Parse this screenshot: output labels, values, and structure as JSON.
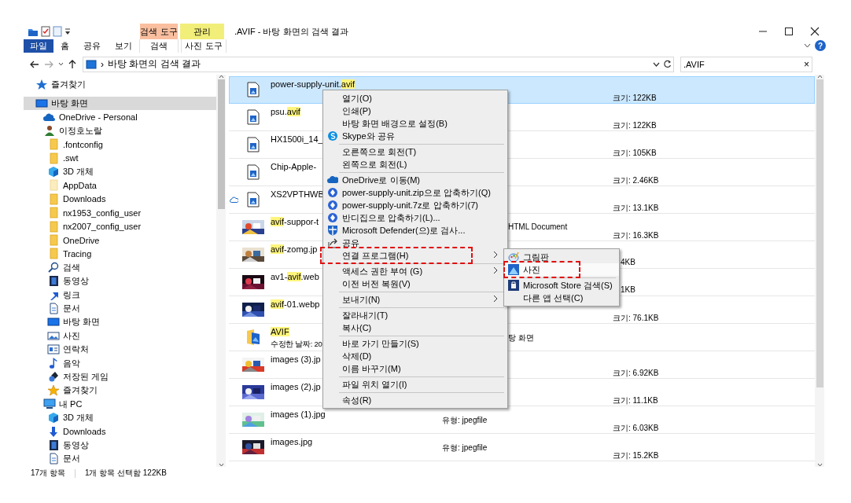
{
  "window": {
    "title": ".AVIF - 바탕 화면의 검색 결과"
  },
  "context_tab_headers": [
    {
      "label": "검색 도구",
      "color": "#f9bf9f"
    },
    {
      "label": "관리",
      "color": "#f2ee7a"
    }
  ],
  "ribbon_tabs": [
    {
      "label": "파일",
      "kind": "file",
      "selected": false
    },
    {
      "label": "홈",
      "kind": "tab",
      "selected": false
    },
    {
      "label": "공유",
      "kind": "tab",
      "selected": false
    },
    {
      "label": "보기",
      "kind": "tab",
      "selected": false
    },
    {
      "label": "검색",
      "kind": "context",
      "selected": false
    },
    {
      "label": "사진 도구",
      "kind": "context",
      "selected": false
    }
  ],
  "help": "?",
  "address_bar": {
    "separator": "›",
    "path": "바탕 화면의 검색 결과"
  },
  "search": {
    "value": ".AVIF",
    "clear": "×"
  },
  "navigation": [
    {
      "label": "즐겨찾기",
      "kind": "star",
      "selected": false
    },
    {
      "label": "바탕 화면",
      "kind": "desktop",
      "selected": true,
      "children": [
        {
          "label": "OneDrive - Personal",
          "kind": "cloud",
          "selected": false
        },
        {
          "label": "이정호노랄",
          "kind": "user",
          "selected": false,
          "children": [
            {
              "label": ".fontconfig",
              "kind": "folder",
              "selected": false
            },
            {
              "label": ".swt",
              "kind": "folder",
              "selected": false
            },
            {
              "label": "3D 개체",
              "kind": "cube",
              "selected": false
            },
            {
              "label": "AppData",
              "kind": "folder-faded",
              "selected": false
            },
            {
              "label": "Downloads",
              "kind": "folder",
              "selected": false
            },
            {
              "label": "nx1953_config_user",
              "kind": "folder",
              "selected": false
            },
            {
              "label": "nx2007_config_user",
              "kind": "folder",
              "selected": false
            },
            {
              "label": "OneDrive",
              "kind": "folder",
              "selected": false
            },
            {
              "label": "Tracing",
              "kind": "folder",
              "selected": false
            },
            {
              "label": "검색",
              "kind": "search",
              "selected": false
            },
            {
              "label": "동영상",
              "kind": "film",
              "selected": false
            },
            {
              "label": "링크",
              "kind": "link",
              "selected": false
            },
            {
              "label": "문서",
              "kind": "doc",
              "selected": false
            },
            {
              "label": "바탕 화면",
              "kind": "desktop",
              "selected": false
            },
            {
              "label": "사진",
              "selected": false
            },
            {
              "label": "연락처",
              "kind": "contact",
              "selected": false
            },
            {
              "label": "음악",
              "kind": "music",
              "selected": false
            },
            {
              "label": "저장된 게임",
              "kind": "game",
              "selected": false
            },
            {
              "label": "즐겨찾기",
              "kind": "star-gold",
              "selected": false
            }
          ]
        },
        {
          "label": "내 PC",
          "kind": "pc",
          "selected": false,
          "children": [
            {
              "label": "3D 개체",
              "kind": "cube",
              "selected": false
            },
            {
              "label": "Downloads",
              "kind": "download",
              "selected": false
            },
            {
              "label": "동영상",
              "kind": "film",
              "selected": false
            },
            {
              "label": "문서",
              "kind": "doc",
              "selected": false
            }
          ]
        }
      ]
    }
  ],
  "files": [
    {
      "kind": "image-file",
      "selected": true,
      "cloud": false,
      "name": [
        {
          "text": "power-supply-unit.",
          "match": false
        },
        {
          "text": "avif",
          "match": true
        }
      ],
      "size": "크기: 122KB"
    },
    {
      "kind": "image-file",
      "selected": false,
      "cloud": false,
      "name": [
        {
          "text": "psu.",
          "match": false
        },
        {
          "text": "avif",
          "match": true
        }
      ],
      "size": "크기: 122KB"
    },
    {
      "kind": "image-file",
      "selected": false,
      "cloud": false,
      "name": [
        {
          "text": "HX1500i_14_",
          "match": false
        }
      ],
      "size": "크기: 105KB"
    },
    {
      "kind": "image-file",
      "selected": false,
      "cloud": false,
      "name": [
        {
          "text": "Chip-Apple-",
          "match": false
        }
      ],
      "size": "크기: 2.46KB"
    },
    {
      "kind": "image-file",
      "selected": false,
      "cloud": true,
      "name": [
        {
          "text": "XS2VPTHWB",
          "match": false
        }
      ],
      "size": "크기: 13.1KB"
    },
    {
      "selected": false,
      "cloud": false,
      "name": [
        {
          "text": "avif",
          "match": true
        },
        {
          "text": "-suppor-t",
          "match": false
        }
      ],
      "type_tail": "HTML Document",
      "size": "크기: 16.3KB"
    },
    {
      "selected": false,
      "cloud": false,
      "name": [
        {
          "text": "avif",
          "match": true
        },
        {
          "text": "-zomg.jp",
          "match": false
        }
      ],
      "size_tail": "4KB"
    },
    {
      "selected": false,
      "cloud": false,
      "name": [
        {
          "text": "av1-",
          "match": false
        },
        {
          "text": "avif",
          "match": true
        },
        {
          "text": ".web",
          "match": false
        }
      ],
      "size_tail": "1KB"
    },
    {
      "selected": false,
      "cloud": false,
      "name": [
        {
          "text": "avif",
          "match": true
        },
        {
          "text": "-01.webp",
          "match": false
        }
      ],
      "size": "크기: 76.1KB"
    },
    {
      "kind": "folder",
      "selected": false,
      "cloud": false,
      "name": [
        {
          "text": "AVIF",
          "match": true
        }
      ],
      "detail": "수정한 날짜: 20",
      "type_tail": "탕 화면"
    },
    {
      "selected": false,
      "cloud": false,
      "name": [
        {
          "text": "images (3).jp",
          "match": false
        }
      ],
      "size": "크기: 6.92KB"
    },
    {
      "selected": false,
      "cloud": false,
      "name": [
        {
          "text": "images (2).jp",
          "match": false
        }
      ],
      "size": "크기: 11.1KB"
    },
    {
      "selected": false,
      "cloud": false,
      "name": [
        {
          "text": "images (1).jpg",
          "match": false
        }
      ],
      "type": "유형: jpegfile",
      "size": "크기: 6.03KB"
    },
    {
      "selected": false,
      "cloud": false,
      "name": [
        {
          "text": "images.jpg",
          "match": false
        }
      ],
      "type": "유형: jpegfile",
      "size": "크기: 15.2KB"
    }
  ],
  "context_menu": {
    "groups": [
      [
        {
          "label": "열기(O)",
          "kind": "plain",
          "submenu": false,
          "marked": false
        },
        {
          "label": "인쇄(P)",
          "kind": "plain",
          "submenu": false,
          "marked": false
        },
        {
          "label": "바탕 화면 배경으로 설정(B)",
          "kind": "plain",
          "submenu": false,
          "marked": false
        },
        {
          "label": "Skype와 공유",
          "kind": "skype",
          "submenu": false,
          "marked": false
        }
      ],
      [
        {
          "label": "오른쪽으로 회전(T)",
          "kind": "plain",
          "submenu": false,
          "marked": false
        },
        {
          "label": "왼쪽으로 회전(L)",
          "kind": "plain",
          "submenu": false,
          "marked": false
        }
      ],
      [
        {
          "label": "OneDrive로 이동(M)",
          "kind": "cloud",
          "submenu": false,
          "marked": false
        },
        {
          "label": "power-supply-unit.zip으로 압축하기(Q)",
          "kind": "zip",
          "submenu": false,
          "marked": false
        },
        {
          "label": "power-supply-unit.7z로 압축하기(7)",
          "kind": "zip",
          "submenu": false,
          "marked": false
        },
        {
          "label": "반디집으로 압축하기(L)...",
          "kind": "zip",
          "submenu": false,
          "marked": false
        },
        {
          "label": "Microsoft Defender(으)로 검사...",
          "kind": "shield",
          "submenu": false,
          "marked": false
        },
        {
          "label": "공유",
          "kind": "share",
          "submenu": false,
          "marked": false
        },
        {
          "label": "연결 프로그램(H)",
          "kind": "plain",
          "submenu": true,
          "marked": true
        }
      ],
      [
        {
          "label": "액세스 권한 부여 (G)",
          "kind": "plain",
          "submenu": true,
          "marked": false
        },
        {
          "label": "이전 버전 복원(V)",
          "kind": "plain",
          "submenu": false,
          "marked": false
        }
      ],
      [
        {
          "label": "보내기(N)",
          "kind": "plain",
          "submenu": true,
          "marked": false
        }
      ],
      [
        {
          "label": "잘라내기(T)",
          "kind": "plain",
          "submenu": false,
          "marked": false
        },
        {
          "label": "복사(C)",
          "kind": "plain",
          "submenu": false,
          "marked": false
        }
      ],
      [
        {
          "label": "바로 가기 만들기(S)",
          "kind": "plain",
          "submenu": false,
          "marked": false
        },
        {
          "label": "삭제(D)",
          "kind": "plain",
          "submenu": false,
          "marked": false
        },
        {
          "label": "이름 바꾸기(M)",
          "kind": "plain",
          "submenu": false,
          "marked": false
        }
      ],
      [
        {
          "label": "파일 위치 열기(I)",
          "kind": "plain",
          "submenu": false,
          "marked": false
        }
      ],
      [
        {
          "label": "속성(R)",
          "kind": "plain",
          "submenu": false,
          "marked": false
        }
      ]
    ]
  },
  "submenu": {
    "groups": [
      [
        {
          "label": "그림판",
          "kind": "paint",
          "selected": false,
          "marked": false
        },
        {
          "label": "사진",
          "kind": "photos",
          "selected": true,
          "marked": true
        }
      ],
      [
        {
          "label": "Microsoft Store 검색(S)",
          "kind": "store",
          "selected": false,
          "marked": false
        },
        {
          "label": "다른 앱 선택(C)",
          "kind": "plain",
          "selected": false,
          "marked": false
        }
      ]
    ]
  },
  "status_bar": {
    "count": "17개 항목",
    "selection": "1개 항목 선택함 122KB"
  }
}
